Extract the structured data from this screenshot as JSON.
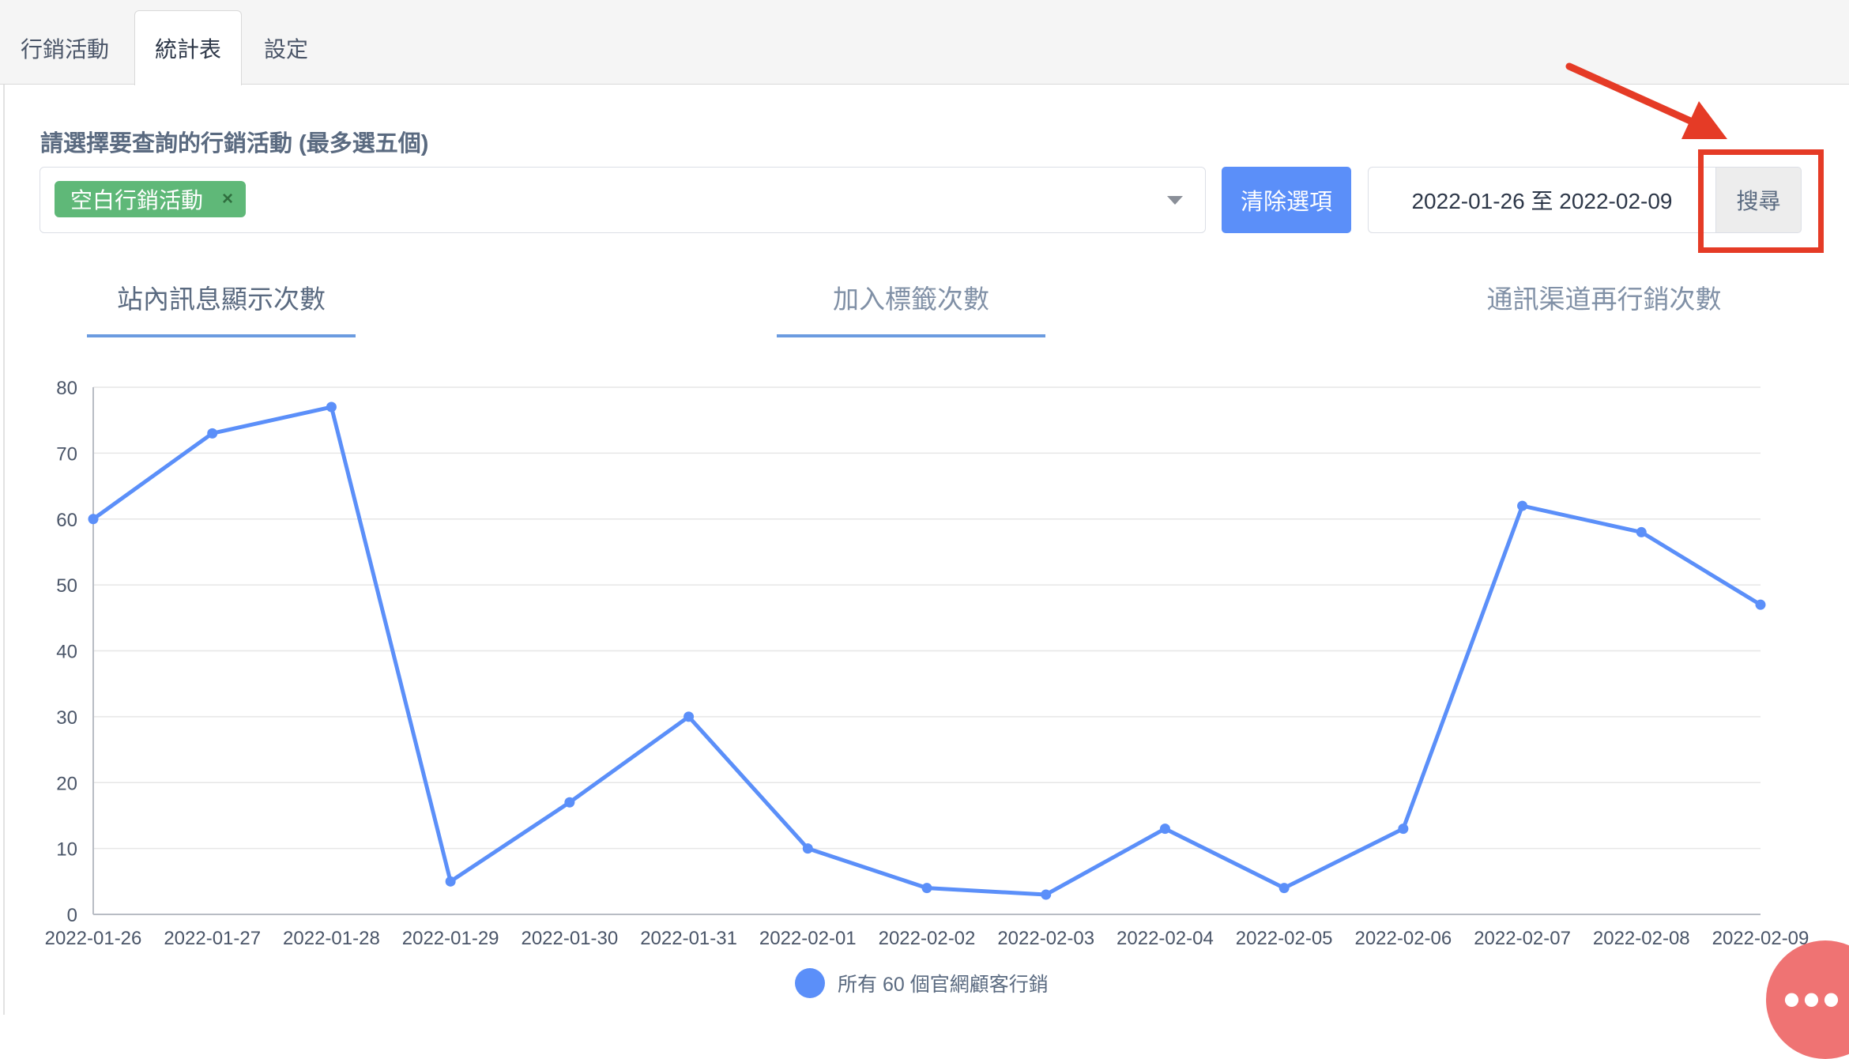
{
  "tabs": [
    {
      "label": "行銷活動",
      "active": false
    },
    {
      "label": "統計表",
      "active": true
    },
    {
      "label": "設定",
      "active": false
    }
  ],
  "filter": {
    "label": "請選擇要查詢的行銷活動 (最多選五個)",
    "selected_chip": "空白行銷活動",
    "chip_remove": "×",
    "clear_button": "清除選項",
    "date_range": "2022-01-26 至 2022-02-09",
    "search_button": "搜尋"
  },
  "metric_tabs": [
    {
      "label": "站內訊息顯示次數",
      "active": true
    },
    {
      "label": "加入標籤次數",
      "active": false
    },
    {
      "label": "通訊渠道再行銷次數",
      "active": false
    }
  ],
  "colors": {
    "accent": "#5b8ff9",
    "chip": "#5fb878",
    "highlight": "#e53b26",
    "line": "#5b8ff9",
    "chat": "#ef7373"
  },
  "chat": {
    "icon": "more-dots-icon",
    "dots": "•••"
  },
  "chart_data": {
    "type": "line",
    "title": "",
    "xlabel": "",
    "ylabel": "",
    "ylim": [
      0,
      80
    ],
    "yticks": [
      0,
      10,
      20,
      30,
      40,
      50,
      60,
      70,
      80
    ],
    "grid": true,
    "legend_position": "bottom",
    "categories": [
      "2022-01-26",
      "2022-01-27",
      "2022-01-28",
      "2022-01-29",
      "2022-01-30",
      "2022-01-31",
      "2022-02-01",
      "2022-02-02",
      "2022-02-03",
      "2022-02-04",
      "2022-02-05",
      "2022-02-06",
      "2022-02-07",
      "2022-02-08",
      "2022-02-09"
    ],
    "series": [
      {
        "name": "所有 60 個官網顧客行銷",
        "values": [
          60,
          73,
          77,
          5,
          17,
          30,
          10,
          4,
          3,
          13,
          4,
          13,
          62,
          58,
          47
        ]
      }
    ]
  }
}
